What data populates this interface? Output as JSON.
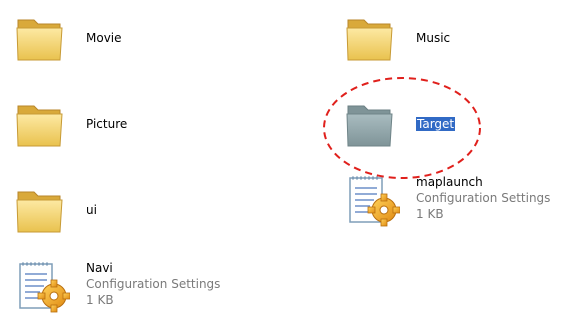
{
  "items": [
    {
      "name": "Movie",
      "type": "folder"
    },
    {
      "name": "Music",
      "type": "folder"
    },
    {
      "name": "Picture",
      "type": "folder"
    },
    {
      "name": "Target",
      "type": "folder",
      "selected": true
    },
    {
      "name": "ui",
      "type": "folder"
    },
    {
      "name": "maplaunch",
      "type": "config",
      "kind": "Configuration Settings",
      "size": "1 KB"
    },
    {
      "name": "Navi",
      "type": "config",
      "kind": "Configuration Settings",
      "size": "1 KB"
    }
  ],
  "colors": {
    "folder_yellow": "#f5d46a",
    "folder_grey": "#8fa3a8",
    "selection": "#316ac5",
    "annotation_red": "#e0201c"
  },
  "icons": {
    "folder": "folder-icon",
    "config": "config-settings-icon"
  }
}
